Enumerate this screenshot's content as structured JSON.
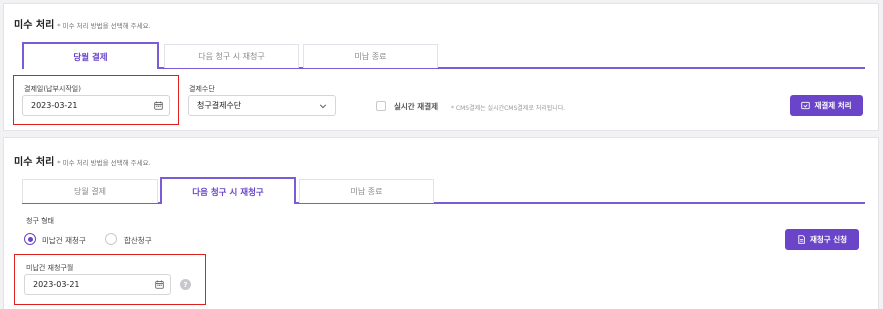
{
  "section1": {
    "title": "미수 처리",
    "subtitle": "* 미수 처리 방법을 선택해 주세요.",
    "tabs": [
      "당월 결제",
      "다음 청구 시 재청구",
      "미납 종료"
    ],
    "payment_date_label": "결제일(납부시작일)",
    "payment_date_value": "2023-03-21",
    "payment_method_label": "결제수단",
    "payment_method_value": "청구결제수단",
    "realtime_label": "실시간 재결제",
    "realtime_hint": "* CMS결제는 실시간CMS결제로 처리됩니다.",
    "repay_button": "재결제 처리"
  },
  "section2": {
    "title": "미수 처리",
    "subtitle": "* 미수 처리 방법을 선택해 주세요.",
    "tabs": [
      "당월 결제",
      "다음 청구 시 재청구",
      "미납 종료"
    ],
    "billing_type_label": "청구 형태",
    "radio_options": [
      "미납건 재청구",
      "합산청구"
    ],
    "rebill_button": "재청구 신청",
    "rebill_month_label": "미납건 재청구월",
    "rebill_month_value": "2023-03-21",
    "help_icon": "?"
  },
  "colors": {
    "accent": "#6a45c9",
    "highlight": "#e0201c"
  },
  "icons": {
    "calendar": "calendar-icon",
    "chevron": "chevron-down-icon",
    "repay": "card-icon",
    "rebill": "document-icon"
  }
}
